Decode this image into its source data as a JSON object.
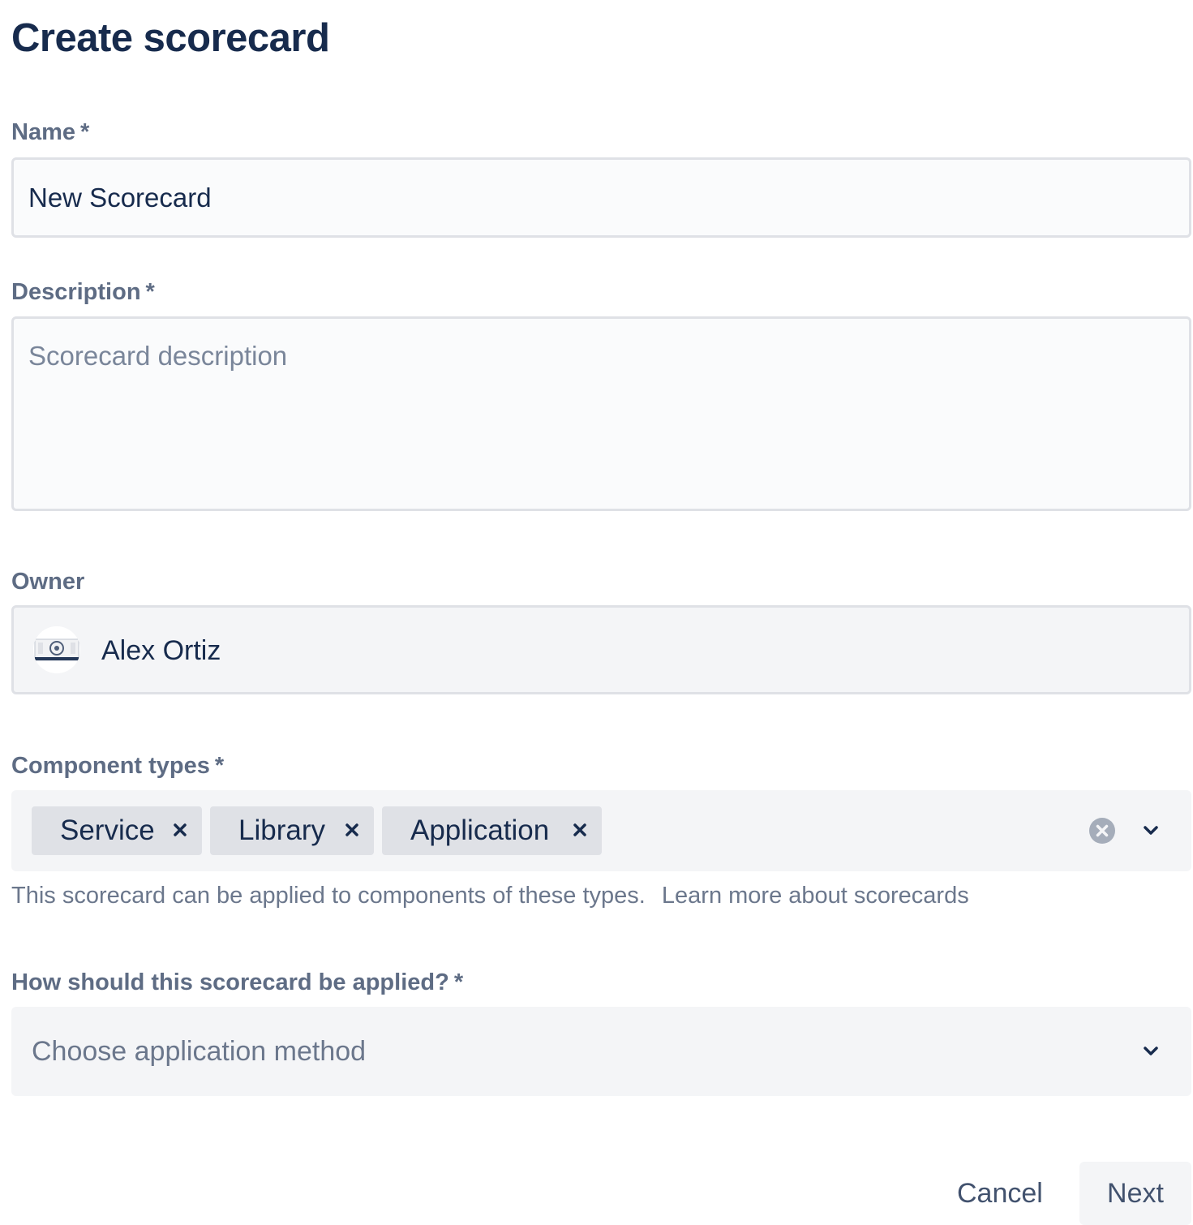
{
  "page": {
    "title": "Create scorecard"
  },
  "form": {
    "name": {
      "label": "Name",
      "required_mark": "*",
      "value": "New Scorecard"
    },
    "description": {
      "label": "Description",
      "required_mark": "*",
      "placeholder": "Scorecard description",
      "value": ""
    },
    "owner": {
      "label": "Owner",
      "value": "Alex Ortiz",
      "avatar_icon": "user-avatar-icon"
    },
    "component_types": {
      "label": "Component types",
      "required_mark": "*",
      "selected": [
        "Service",
        "Library",
        "Application"
      ],
      "helper_text": "This scorecard can be applied to components of these types.",
      "helper_link": "Learn more about scorecards",
      "clear_icon": "clear-circle-icon",
      "dropdown_icon": "chevron-down-icon"
    },
    "application_method": {
      "label": "How should this scorecard be applied?",
      "required_mark": "*",
      "placeholder": "Choose application method",
      "dropdown_icon": "chevron-down-icon"
    }
  },
  "actions": {
    "cancel_label": "Cancel",
    "next_label": "Next"
  },
  "colors": {
    "text_primary": "#172b4d",
    "label": "#5e6c84",
    "field_bg": "#f4f5f7",
    "field_border": "#dfe1e6",
    "chip_bg": "#dfe1e6"
  }
}
